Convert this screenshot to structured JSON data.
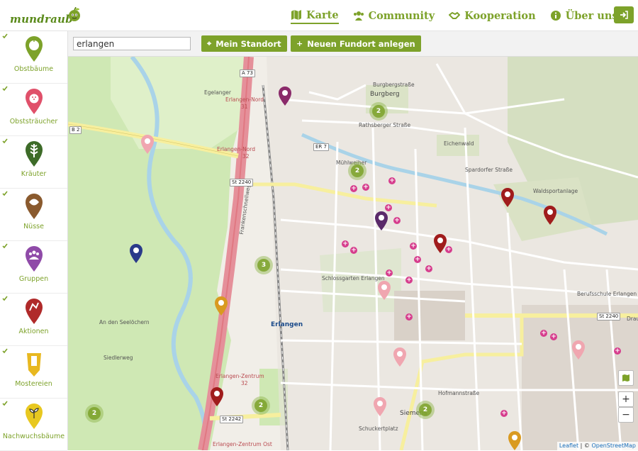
{
  "brand": {
    "name": "mundraub"
  },
  "nav": {
    "items": [
      {
        "label": "Karte",
        "icon": "map-icon",
        "active": true
      },
      {
        "label": "Community",
        "icon": "users-icon",
        "active": false
      },
      {
        "label": "Kooperation",
        "icon": "handshake-icon",
        "active": false
      },
      {
        "label": "Über uns",
        "icon": "info-icon",
        "active": false
      }
    ],
    "login_icon": "sign-in-icon"
  },
  "categories": [
    {
      "label": "Obstbäume",
      "icon": "apple-pin-icon",
      "color": "#7da22a",
      "checked": true
    },
    {
      "label": "Obststräucher",
      "icon": "berry-pin-icon",
      "color": "#e0506a",
      "checked": true
    },
    {
      "label": "Kräuter",
      "icon": "herb-pin-icon",
      "color": "#3d6b28",
      "checked": true
    },
    {
      "label": "Nüsse",
      "icon": "nut-pin-icon",
      "color": "#8a5a2e",
      "checked": true
    },
    {
      "label": "Gruppen",
      "icon": "group-pin-icon",
      "color": "#8f4aa8",
      "checked": true
    },
    {
      "label": "Aktionen",
      "icon": "action-pin-icon",
      "color": "#b02a2a",
      "checked": true
    },
    {
      "label": "Mostereien",
      "icon": "cider-pin-icon",
      "color": "#e8b820",
      "checked": true
    },
    {
      "label": "Nachwuchsbäume",
      "icon": "sapling-pin-icon",
      "color": "#e8c820",
      "checked": true
    }
  ],
  "toolbar": {
    "search_value": "erlangen",
    "location_button": "Mein Standort",
    "new_spot_button": "Neuen Fundort anlegen"
  },
  "map": {
    "labels": {
      "burgberg": "Burgberg",
      "erlangen": "Erlangen",
      "erlangen_nord": "Erlangen-Nord",
      "erlangen_nord_num": "31",
      "erlangen_nord2": "Erlangen-Nord",
      "erlangen_nord2_num": "32",
      "erlangen_zentrum": "Erlangen-Zentrum",
      "erlangen_zentrum_num": "32",
      "erlangen_zentrum_ost": "Erlangen-Zentrum Ost",
      "schlossgarten": "Schlossgarten Erlangen",
      "waldsportanlage": "Waldsportanlage",
      "berufsschule": "Berufsschule Erlangen",
      "siemens": "Siemens",
      "schuckertplatz": "Schuckertplatz",
      "egelanger": "Egelanger",
      "eichenwald": "Eichenwald",
      "muehlweg": "Mühlweiher",
      "burgbergstrasse": "Burgbergstraße",
      "rathsberger": "Rathsberger Straße",
      "spardorfer": "Spardorfer Straße",
      "drausnickstr": "Drausnickstraße",
      "hofmannstr": "Hofmannstraße",
      "frankenschnellweg": "Frankenschnellweg",
      "an_den_seelochern": "An den Seelöchern",
      "siedlerweg": "Siedlerweg"
    },
    "shields": {
      "a73_top": "A 73",
      "st2240_left": "St 2240",
      "er7": "ER 7",
      "b2": "B 2",
      "st2240_right": "St 2240",
      "st2242": "St 2242"
    },
    "clusters": [
      {
        "count": "2"
      },
      {
        "count": "2"
      },
      {
        "count": "3"
      },
      {
        "count": "2"
      },
      {
        "count": "2"
      },
      {
        "count": "2"
      }
    ],
    "zoom_in": "+",
    "zoom_out": "−",
    "attribution": {
      "leaflet": "Leaflet",
      "sep": " | © ",
      "osm": "OpenStreetMap"
    }
  }
}
